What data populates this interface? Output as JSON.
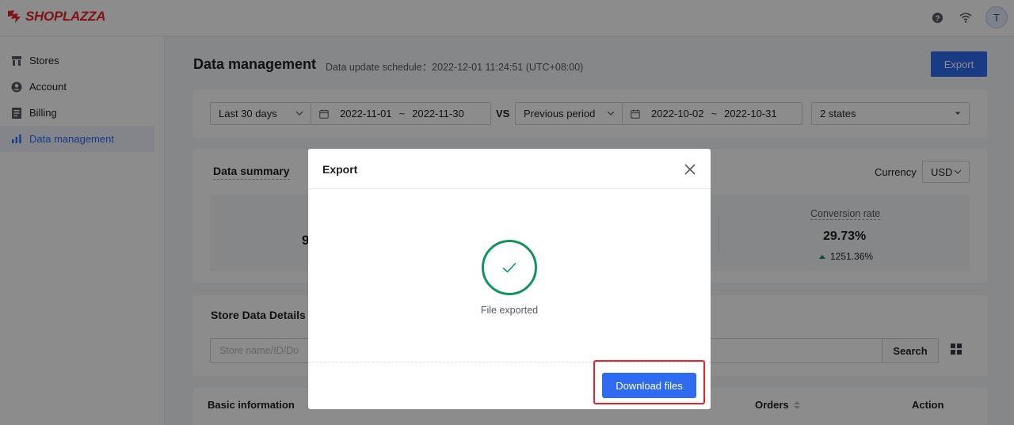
{
  "brand": {
    "name": "SHOPLAZZA",
    "color": "#e8232b"
  },
  "topbar": {
    "icons": [
      "help-icon",
      "wifi-icon"
    ],
    "avatar_initial": "T"
  },
  "sidebar": {
    "items": [
      {
        "label": "Stores",
        "icon": "store-icon",
        "active": false
      },
      {
        "label": "Account",
        "icon": "account-icon",
        "active": false
      },
      {
        "label": "Billing",
        "icon": "billing-icon",
        "active": false
      },
      {
        "label": "Data management",
        "icon": "bar-chart-icon",
        "active": true
      }
    ]
  },
  "page": {
    "title": "Data management",
    "update_info": "Data update schedule：2022-12-01 11:24:51 (UTC+08:00)",
    "export_label": "Export"
  },
  "filters": {
    "range_select": "Last 30 days",
    "current_start": "2022-11-01",
    "current_end": "2022-11-30",
    "range_sep": "~",
    "vs_label": "VS",
    "compare_select": "Previous period",
    "compare_start": "2022-10-02",
    "compare_end": "2022-10-31",
    "states_select": "2 states"
  },
  "summary": {
    "title": "Data summary",
    "currency_label": "Currency",
    "currency_value": "USD",
    "partial_value": "9",
    "conversion_label": "Conversion rate",
    "conversion_value": "29.73%",
    "conversion_delta": "1251.36%",
    "delta_color": "#0e8a5f"
  },
  "details": {
    "title": "Store Data Details",
    "search_placeholder": "Store name/ID/Do",
    "search_label": "Search"
  },
  "table": {
    "columns": [
      "Basic information",
      "Orders",
      "Action"
    ]
  },
  "modal": {
    "title": "Export",
    "message": "File exported",
    "download_label": "Download files",
    "accent": "#2f6bf0",
    "success_color": "#14935c"
  }
}
